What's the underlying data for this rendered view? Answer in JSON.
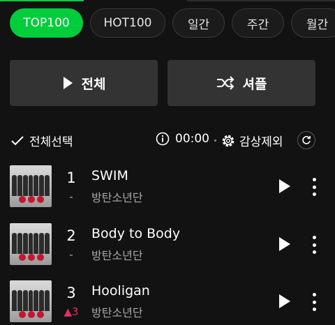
{
  "tabs": [
    {
      "label": "TOP100",
      "active": true
    },
    {
      "label": "HOT100",
      "active": false
    },
    {
      "label": "일간",
      "active": false
    },
    {
      "label": "주간",
      "active": false
    },
    {
      "label": "월간",
      "active": false
    }
  ],
  "controls": {
    "play_all_label": "전체",
    "shuffle_label": "셔플"
  },
  "toolbar": {
    "select_all_label": "전체선택",
    "timer_value": "00:00",
    "exclude_label": "감상제외"
  },
  "tracks": [
    {
      "rank": "1",
      "change": "-",
      "title": "SWIM",
      "artist": "방탄소년단"
    },
    {
      "rank": "2",
      "change": "-",
      "title": "Body to Body",
      "artist": "방탄소년단"
    },
    {
      "rank": "3",
      "change": "▲3",
      "title": "Hooligan",
      "artist": "방탄소년단"
    }
  ],
  "colors": {
    "accent": "#00cd3c",
    "rank_up": "#e2305a",
    "background": "#121212"
  },
  "icons": [
    "play-icon",
    "shuffle-icon",
    "check-icon",
    "info-icon",
    "gear-icon",
    "refresh-icon",
    "more-icon"
  ]
}
